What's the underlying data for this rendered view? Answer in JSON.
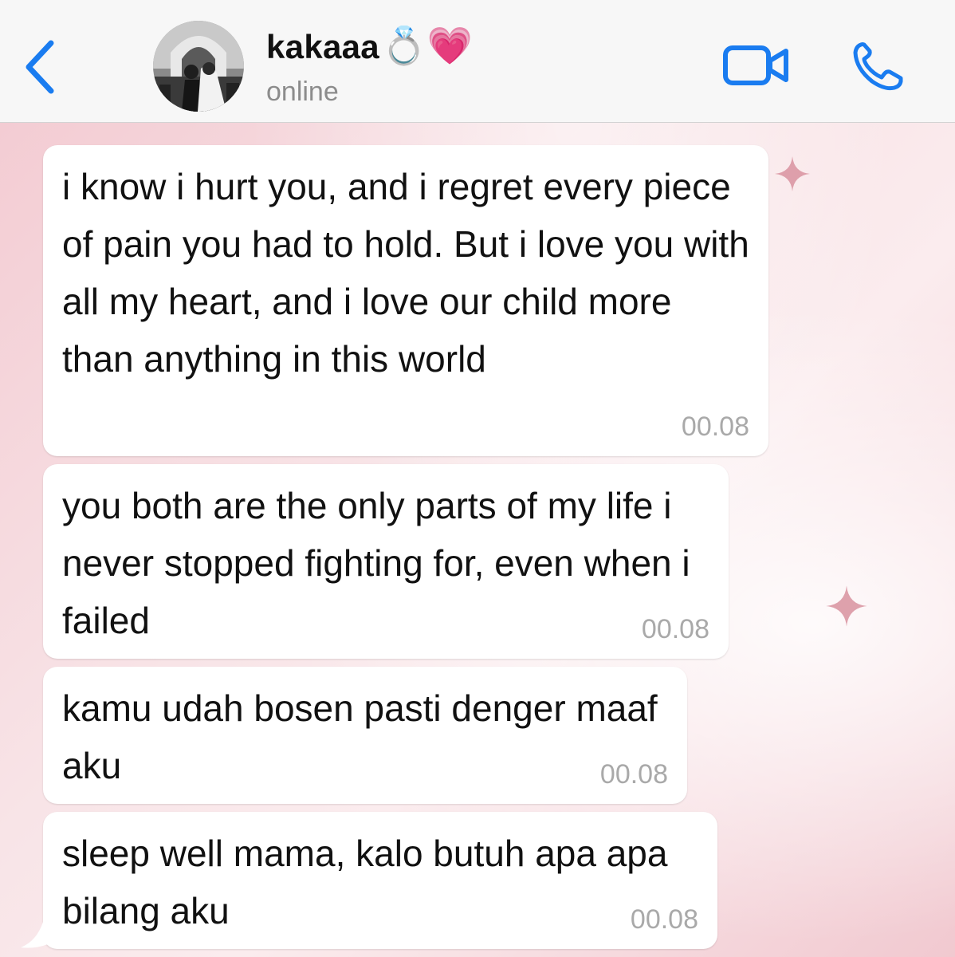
{
  "header": {
    "back_label": "",
    "contact_name": "kakaaa",
    "name_emoji": "💍💗",
    "status": "online"
  },
  "icons": {
    "back": "chevron-left-icon",
    "video": "video-camera-icon",
    "call": "phone-icon",
    "accent": "#1a7cf0"
  },
  "messages": [
    {
      "text": "i know i hurt you, and i regret every piece of pain you had to hold. But i love you with all my heart, and i love our child more than anything in this world",
      "time": "00.08"
    },
    {
      "text": "you both are the only parts of my life i never stopped fighting for, even when i failed",
      "time": "00.08"
    },
    {
      "text": "kamu udah bosen pasti denger maaf aku",
      "time": "00.08"
    },
    {
      "text": "sleep well mama, kalo butuh apa apa bilang aku",
      "time": "00.08"
    }
  ]
}
